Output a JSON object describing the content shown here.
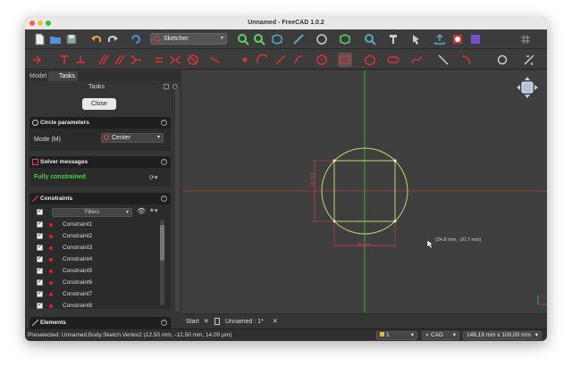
{
  "window": {
    "title": "Unnamed - FreeCAD 1.0.2"
  },
  "toolbar": {
    "workbench": "Sketcher",
    "icons_row1": [
      "new-file-icon",
      "open-file-icon",
      "save-file-icon",
      "undo-icon",
      "redo-icon",
      "refresh-icon",
      "fit-all-icon",
      "fit-selection-icon",
      "view-box-icon",
      "measure-icon",
      "draw-style-icon",
      "std-view-icon",
      "zoom-icon",
      "tape-icon",
      "select-arrow-icon",
      "export-icon",
      "link-icon",
      "part-icon",
      "grid-icon"
    ],
    "icons_row2": [
      "sketch-leave-icon",
      "constraint-icon",
      "constrain-horizontal-icon",
      "constrain-parallel-icon",
      "constrain-perpendicular-icon",
      "constrain-angle-icon",
      "constrain-equal-icon",
      "constrain-symmetric-icon",
      "constrain-block-icon",
      "line-icon",
      "point-icon",
      "arc-icon",
      "polyline-icon",
      "slash-icon",
      "circle-icon",
      "rectangle-icon",
      "polygon-icon",
      "slot-icon",
      "bspline-icon",
      "external-geo-icon",
      "fillet-icon",
      "trim-icon",
      "rotate-icon",
      "tool-icon"
    ]
  },
  "left_panel": {
    "tabs": [
      "Model",
      "Tasks"
    ],
    "title": "Tasks",
    "close_label": "Close",
    "circle_params": {
      "header": "Circle parameters",
      "mode_label": "Mode (M)",
      "mode_value": "Center"
    },
    "solver": {
      "header": "Solver messages",
      "status": "Fully constrained"
    },
    "constraints": {
      "header": "Constraints",
      "filter_label": "Filters",
      "items": [
        "Constraint1",
        "Constraint2",
        "Constraint3",
        "Constraint4",
        "Constraint5",
        "Constraint6",
        "Constraint7",
        "Constraint8"
      ]
    },
    "elements_header": "Elements"
  },
  "viewport": {
    "cursor_label": "(24.8 mm, -20.7 mm)",
    "dim_horizontal": "25 mm",
    "dim_vertical": "25 mm"
  },
  "doc_tabs": [
    "Start",
    "Unnamed : 1*"
  ],
  "status": {
    "message": "Preselected: Unnamed.Body.Sketch.Vertex2 (12.50 mm, -12.50 mm, 14.00 μm)",
    "units_count": "1",
    "nav_style": "CAD",
    "dimensions": "149,19 mm x 100,00 mm"
  },
  "colors": {
    "axis_x": "#c03a3a",
    "axis_y": "#3aa83a",
    "geometry": "#c9d46a",
    "constraint": "#cc4444",
    "success": "#4ccf4c"
  }
}
